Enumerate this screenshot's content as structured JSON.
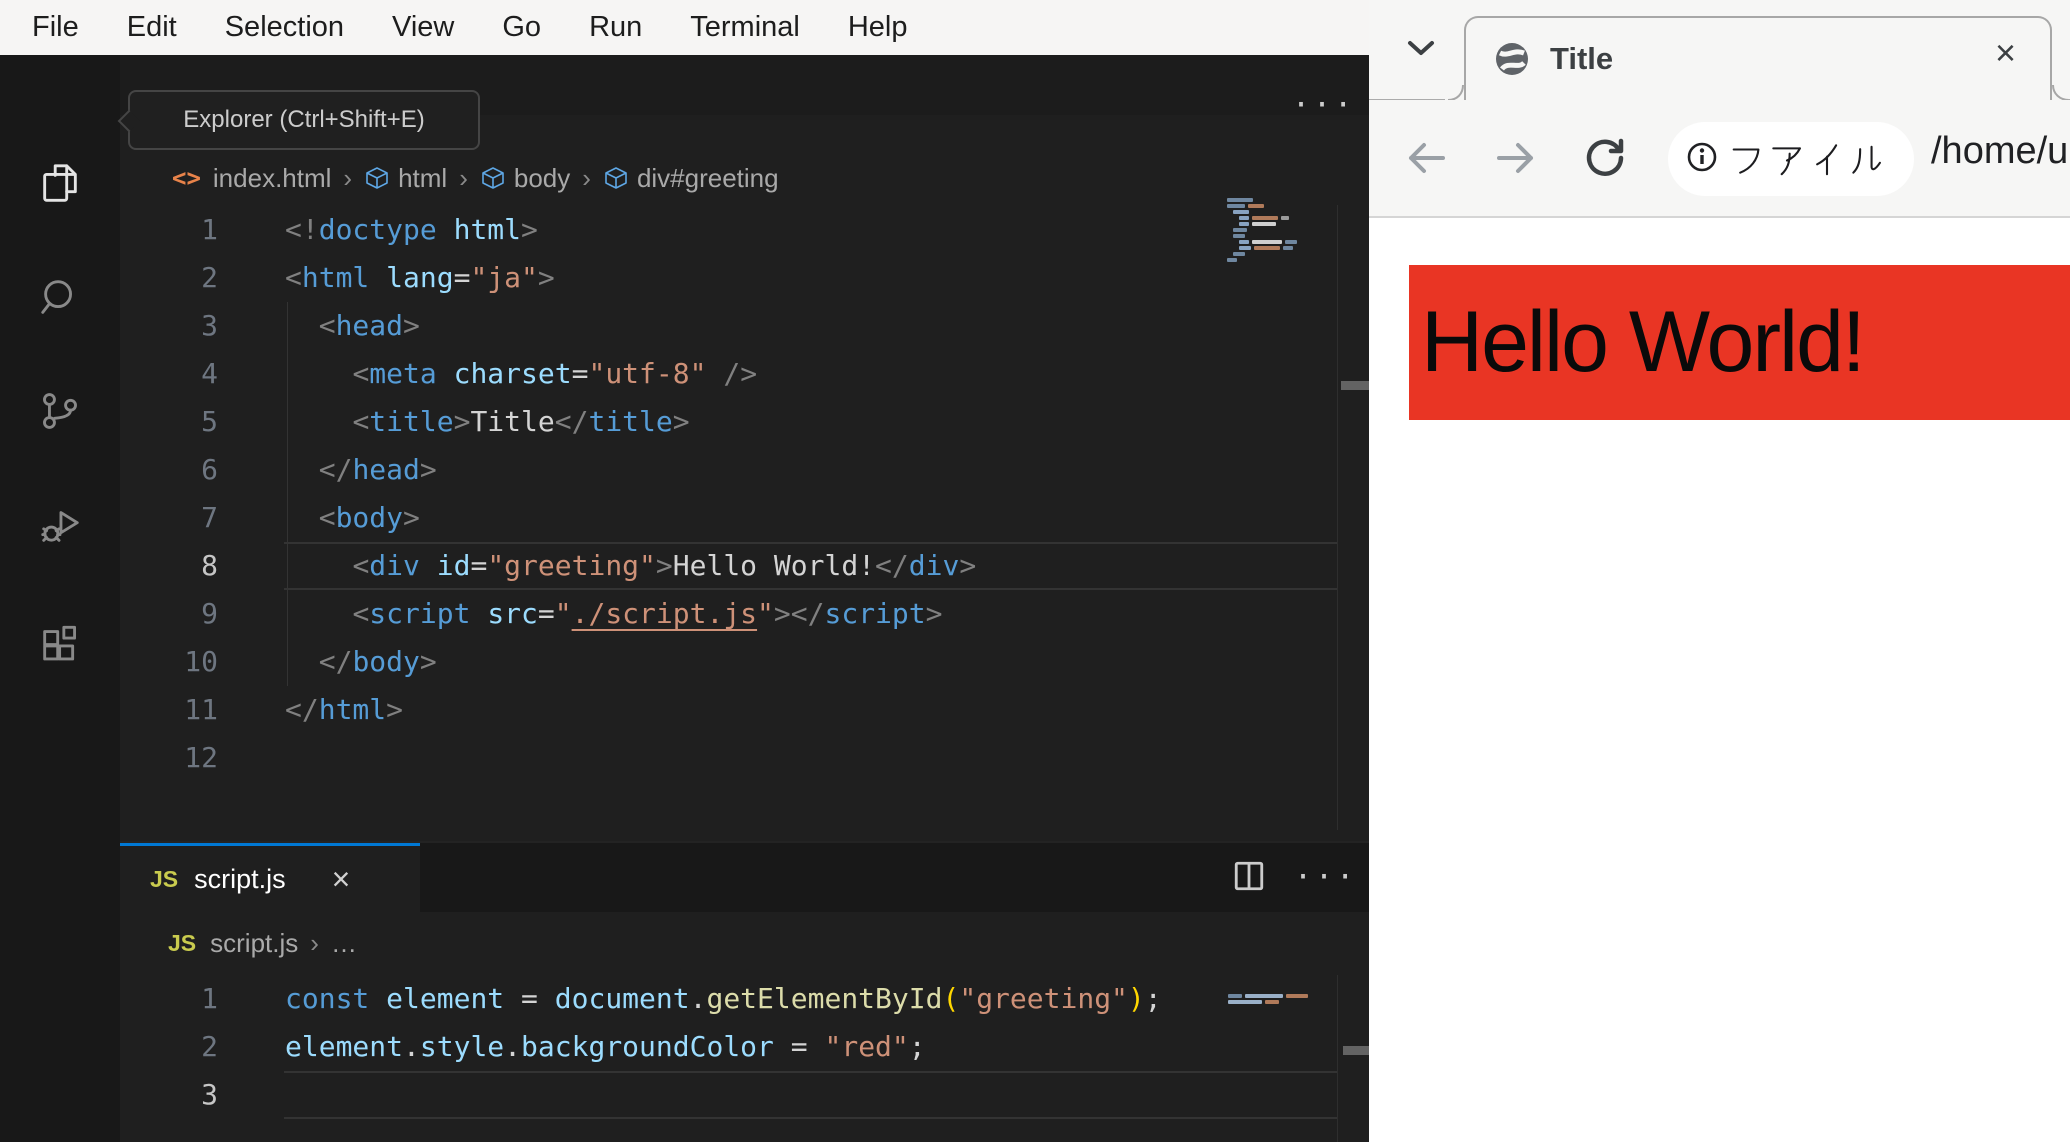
{
  "ui": {
    "accent_color": "#0078d4",
    "editor_bg": "#1f1f1f",
    "activity_bar_bg": "#181818",
    "menu_bar_bg": "#f6f5f4"
  },
  "menu_bar": {
    "items": [
      "File",
      "Edit",
      "Selection",
      "View",
      "Go",
      "Run",
      "Terminal",
      "Help"
    ]
  },
  "activity_bar": {
    "icons": [
      {
        "name": "explorer-icon",
        "active": true
      },
      {
        "name": "search-icon",
        "active": false
      },
      {
        "name": "source-control-icon",
        "active": false
      },
      {
        "name": "run-debug-icon",
        "active": false
      },
      {
        "name": "extensions-icon",
        "active": false
      }
    ]
  },
  "tooltip": {
    "text": "Explorer (Ctrl+Shift+E)"
  },
  "syntax_colors": {
    "p": "#808080",
    "t": "#569cd6",
    "a": "#9cdcfe",
    "s": "#ce9178",
    "x": "#d4d4d4",
    "k": "#569cd6",
    "v": "#9cdcfe",
    "f": "#dcdcaa",
    "g": "#ffd700",
    "o": "#d4d4d4",
    "l": "#ce9178"
  },
  "editor": {
    "actions": {
      "ellipsis": "···"
    },
    "breadcrumb": {
      "file_icon": "<>",
      "file": "index.html",
      "separator": "›",
      "segments": [
        "html",
        "body",
        "div#greeting"
      ]
    },
    "active_line": 8,
    "lines": [
      {
        "n": 1,
        "tokens": [
          [
            "<!",
            "p"
          ],
          [
            "doctype",
            "t"
          ],
          [
            " html",
            "a"
          ],
          [
            ">",
            "p"
          ]
        ]
      },
      {
        "n": 2,
        "tokens": [
          [
            "<",
            "p"
          ],
          [
            "html",
            "t"
          ],
          [
            " ",
            "x"
          ],
          [
            "lang",
            "a"
          ],
          [
            "=",
            "o"
          ],
          [
            "\"ja\"",
            "s"
          ],
          [
            ">",
            "p"
          ]
        ]
      },
      {
        "n": 3,
        "tokens": [
          [
            "  ",
            "x"
          ],
          [
            "<",
            "p"
          ],
          [
            "head",
            "t"
          ],
          [
            ">",
            "p"
          ]
        ]
      },
      {
        "n": 4,
        "tokens": [
          [
            "    ",
            "x"
          ],
          [
            "<",
            "p"
          ],
          [
            "meta",
            "t"
          ],
          [
            " ",
            "x"
          ],
          [
            "charset",
            "a"
          ],
          [
            "=",
            "o"
          ],
          [
            "\"utf-8\"",
            "s"
          ],
          [
            " />",
            "p"
          ]
        ]
      },
      {
        "n": 5,
        "tokens": [
          [
            "    ",
            "x"
          ],
          [
            "<",
            "p"
          ],
          [
            "title",
            "t"
          ],
          [
            ">",
            "p"
          ],
          [
            "Title",
            "x"
          ],
          [
            "</",
            "p"
          ],
          [
            "title",
            "t"
          ],
          [
            ">",
            "p"
          ]
        ]
      },
      {
        "n": 6,
        "tokens": [
          [
            "  ",
            "x"
          ],
          [
            "</",
            "p"
          ],
          [
            "head",
            "t"
          ],
          [
            ">",
            "p"
          ]
        ]
      },
      {
        "n": 7,
        "tokens": [
          [
            "  ",
            "x"
          ],
          [
            "<",
            "p"
          ],
          [
            "body",
            "t"
          ],
          [
            ">",
            "p"
          ]
        ]
      },
      {
        "n": 8,
        "tokens": [
          [
            "    ",
            "x"
          ],
          [
            "<",
            "p"
          ],
          [
            "div",
            "t"
          ],
          [
            " ",
            "x"
          ],
          [
            "id",
            "a"
          ],
          [
            "=",
            "o"
          ],
          [
            "\"greeting\"",
            "s"
          ],
          [
            ">",
            "p"
          ],
          [
            "Hello World!",
            "x"
          ],
          [
            "</",
            "p"
          ],
          [
            "div",
            "t"
          ],
          [
            ">",
            "p"
          ]
        ]
      },
      {
        "n": 9,
        "tokens": [
          [
            "    ",
            "x"
          ],
          [
            "<",
            "p"
          ],
          [
            "script",
            "t"
          ],
          [
            " ",
            "x"
          ],
          [
            "src",
            "a"
          ],
          [
            "=",
            "o"
          ],
          [
            "\"",
            "s"
          ],
          [
            "./script.js",
            "l"
          ],
          [
            "\"",
            "s"
          ],
          [
            ">",
            "p"
          ],
          [
            "</",
            "p"
          ],
          [
            "script",
            "t"
          ],
          [
            ">",
            "p"
          ]
        ]
      },
      {
        "n": 10,
        "tokens": [
          [
            "  ",
            "x"
          ],
          [
            "</",
            "p"
          ],
          [
            "body",
            "t"
          ],
          [
            ">",
            "p"
          ]
        ]
      },
      {
        "n": 11,
        "tokens": [
          [
            "</",
            "p"
          ],
          [
            "html",
            "t"
          ],
          [
            ">",
            "p"
          ]
        ]
      },
      {
        "n": 12,
        "tokens": []
      }
    ]
  },
  "panel": {
    "tab": {
      "icon_label": "JS",
      "label": "script.js",
      "close": "×"
    },
    "actions": {
      "ellipsis": "···"
    },
    "breadcrumb": {
      "icon_label": "JS",
      "file": "script.js",
      "separator": "›",
      "more": "…"
    },
    "active_line": 3,
    "lines": [
      {
        "n": 1,
        "tokens": [
          [
            "const",
            "k"
          ],
          [
            " ",
            "x"
          ],
          [
            "element",
            "v"
          ],
          [
            " ",
            "x"
          ],
          [
            "=",
            "o"
          ],
          [
            " ",
            "x"
          ],
          [
            "document",
            "v"
          ],
          [
            ".",
            "o"
          ],
          [
            "getElementById",
            "f"
          ],
          [
            "(",
            "g"
          ],
          [
            "\"greeting\"",
            "s"
          ],
          [
            ")",
            "g"
          ],
          [
            ";",
            "o"
          ]
        ]
      },
      {
        "n": 2,
        "tokens": [
          [
            "element",
            "v"
          ],
          [
            ".",
            "o"
          ],
          [
            "style",
            "v"
          ],
          [
            ".",
            "o"
          ],
          [
            "backgroundColor",
            "v"
          ],
          [
            " ",
            "x"
          ],
          [
            "=",
            "o"
          ],
          [
            " ",
            "x"
          ],
          [
            "\"red\"",
            "s"
          ],
          [
            ";",
            "o"
          ]
        ]
      },
      {
        "n": 3,
        "tokens": []
      }
    ]
  },
  "minimap": {
    "top_rows": [
      {
        "i": 0,
        "seg": [
          [
            26,
            "#6f87a0"
          ]
        ]
      },
      {
        "i": 0,
        "seg": [
          [
            18,
            "#6f87a0"
          ],
          [
            16,
            "#b07a5a"
          ]
        ]
      },
      {
        "i": 6,
        "seg": [
          [
            16,
            "#88a2c0"
          ]
        ]
      },
      {
        "i": 12,
        "seg": [
          [
            10,
            "#88a2c0"
          ],
          [
            26,
            "#b07a5a"
          ],
          [
            8,
            "#9a9a9a"
          ]
        ]
      },
      {
        "i": 12,
        "seg": [
          [
            10,
            "#88a2c0"
          ],
          [
            24,
            "#cfcfcf"
          ]
        ]
      },
      {
        "i": 6,
        "seg": [
          [
            14,
            "#6f87a0"
          ]
        ]
      },
      {
        "i": 6,
        "seg": [
          [
            12,
            "#6f87a0"
          ]
        ]
      },
      {
        "i": 12,
        "seg": [
          [
            10,
            "#88a2c0"
          ],
          [
            30,
            "#cfcfcf"
          ],
          [
            12,
            "#6f87a0"
          ]
        ]
      },
      {
        "i": 12,
        "seg": [
          [
            12,
            "#88a2c0"
          ],
          [
            26,
            "#b07a5a"
          ],
          [
            10,
            "#6f87a0"
          ]
        ]
      },
      {
        "i": 6,
        "seg": [
          [
            12,
            "#6f87a0"
          ]
        ]
      },
      {
        "i": 0,
        "seg": [
          [
            10,
            "#6f87a0"
          ]
        ]
      }
    ],
    "bottom_rows": [
      {
        "i": 0,
        "seg": [
          [
            14,
            "#6f87a0"
          ],
          [
            38,
            "#9ab0c8"
          ],
          [
            22,
            "#b07a5a"
          ]
        ]
      },
      {
        "i": 0,
        "seg": [
          [
            34,
            "#9ab0c8"
          ],
          [
            14,
            "#b07a5a"
          ]
        ]
      }
    ]
  },
  "browser": {
    "tab": {
      "title": "Title",
      "close": "×"
    },
    "toolbar": {
      "chip_label": "ファイル",
      "url": "/home/u"
    },
    "page": {
      "heading": "Hello World!",
      "heading_bg": "#e93524",
      "heading_color": "#0a0a0a"
    }
  }
}
